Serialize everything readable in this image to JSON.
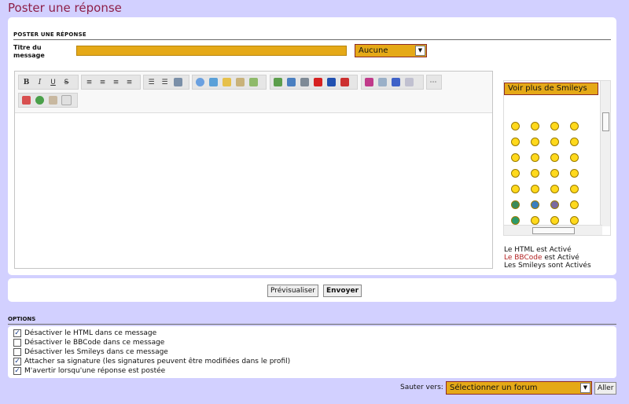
{
  "page_title": "Poster une réponse",
  "form": {
    "section_title": "POSTER UNE RÉPONSE",
    "title_label": "Titre du message",
    "title_value": "",
    "icon_select": "Aucune"
  },
  "smileys": {
    "more_button": "Voir plus de Smileys"
  },
  "status": {
    "html": "Le HTML est Activé",
    "bbcode_link": "Le BBCode",
    "bbcode_rest": " est Activé",
    "smileys": "Les Smileys sont Activés"
  },
  "buttons": {
    "preview": "Prévisualiser",
    "send": "Envoyer"
  },
  "options": {
    "title": "OPTIONS",
    "items": [
      {
        "label": "Désactiver le HTML dans ce message",
        "checked": true
      },
      {
        "label": "Désactiver le BBCode dans ce message",
        "checked": false
      },
      {
        "label": "Désactiver les Smileys dans ce message",
        "checked": false
      },
      {
        "label": "Attacher sa signature (les signatures peuvent être modifiées dans le profil)",
        "checked": true
      },
      {
        "label": "M'avertir lorsqu'une réponse est postée",
        "checked": true
      }
    ]
  },
  "jump": {
    "label": "Sauter vers:",
    "select": "Sélectionner un forum",
    "go": "Aller"
  },
  "colors": {
    "accent": "#e5a917",
    "title": "#8e1f48",
    "background": "#d2d0ff"
  }
}
